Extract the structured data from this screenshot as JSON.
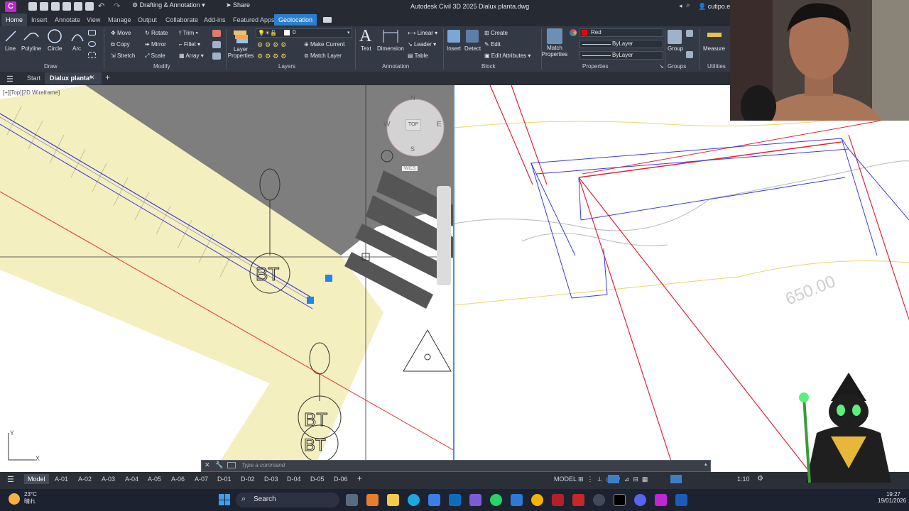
{
  "app": {
    "logo_letter": "C",
    "workspace": "Drafting & Annotation",
    "share": "Share",
    "title": "Autodesk Civil 3D 2025   Dialux planta.dwg",
    "user": "cutipo.e"
  },
  "ribbon_tabs": [
    "Home",
    "Insert",
    "Annotate",
    "View",
    "Manage",
    "Output",
    "Collaborate",
    "Add-ins",
    "Featured Apps",
    "Geolocation"
  ],
  "draw": {
    "line": "Line",
    "polyline": "Polyline",
    "circle": "Circle",
    "arc": "Arc",
    "panel": "Draw"
  },
  "modify": {
    "move": "Move",
    "rotate": "Rotate",
    "trim": "Trim",
    "copy": "Copy",
    "mirror": "Mirror",
    "fillet": "Fillet",
    "stretch": "Stretch",
    "scale": "Scale",
    "array": "Array",
    "panel": "Modify"
  },
  "layers": {
    "props": "Layer Properties",
    "current_layer": "0",
    "make_current": "Make Current",
    "match_layer": "Match Layer",
    "panel": "Layers"
  },
  "annotation": {
    "text": "Text",
    "dimension": "Dimension",
    "linear": "Linear",
    "leader": "Leader",
    "table": "Table",
    "panel": "Annotation"
  },
  "block": {
    "insert": "Insert",
    "detect": "Detect",
    "create": "Create",
    "edit": "Edit",
    "edit_attributes": "Edit Attributes",
    "panel": "Block"
  },
  "properties": {
    "match": "Match Properties",
    "color": "Red",
    "linetype": "ByLayer",
    "lineweight": "ByLayer",
    "panel": "Properties"
  },
  "groups": {
    "group": "Group",
    "panel": "Groups"
  },
  "utilities": {
    "measure": "Measure",
    "panel": "Utilities"
  },
  "doc_tabs": {
    "start": "Start",
    "current": "Dialux planta*"
  },
  "viewport": {
    "label": "[+][Top][2D Wireframe]",
    "viewcube_top": "TOP",
    "n": "N",
    "w": "W",
    "e": "E",
    "s": "S",
    "wcs": "WCS",
    "elevation": "650.00",
    "ucs_y": "Y",
    "ucs_x": "X"
  },
  "command": {
    "placeholder": "Type a command"
  },
  "layouts": [
    "Model",
    "A-01",
    "A-02",
    "A-03",
    "A-04",
    "A-05",
    "A-06",
    "A-07",
    "D-01",
    "D-02",
    "D-03",
    "D-04",
    "D-05",
    "D-06"
  ],
  "status": {
    "model": "MODEL",
    "scale": "1:10"
  },
  "taskbar": {
    "temp": "23°C",
    "weather": "晴れ",
    "search": "Search",
    "time": "19:27",
    "date": "19/01/2026"
  }
}
